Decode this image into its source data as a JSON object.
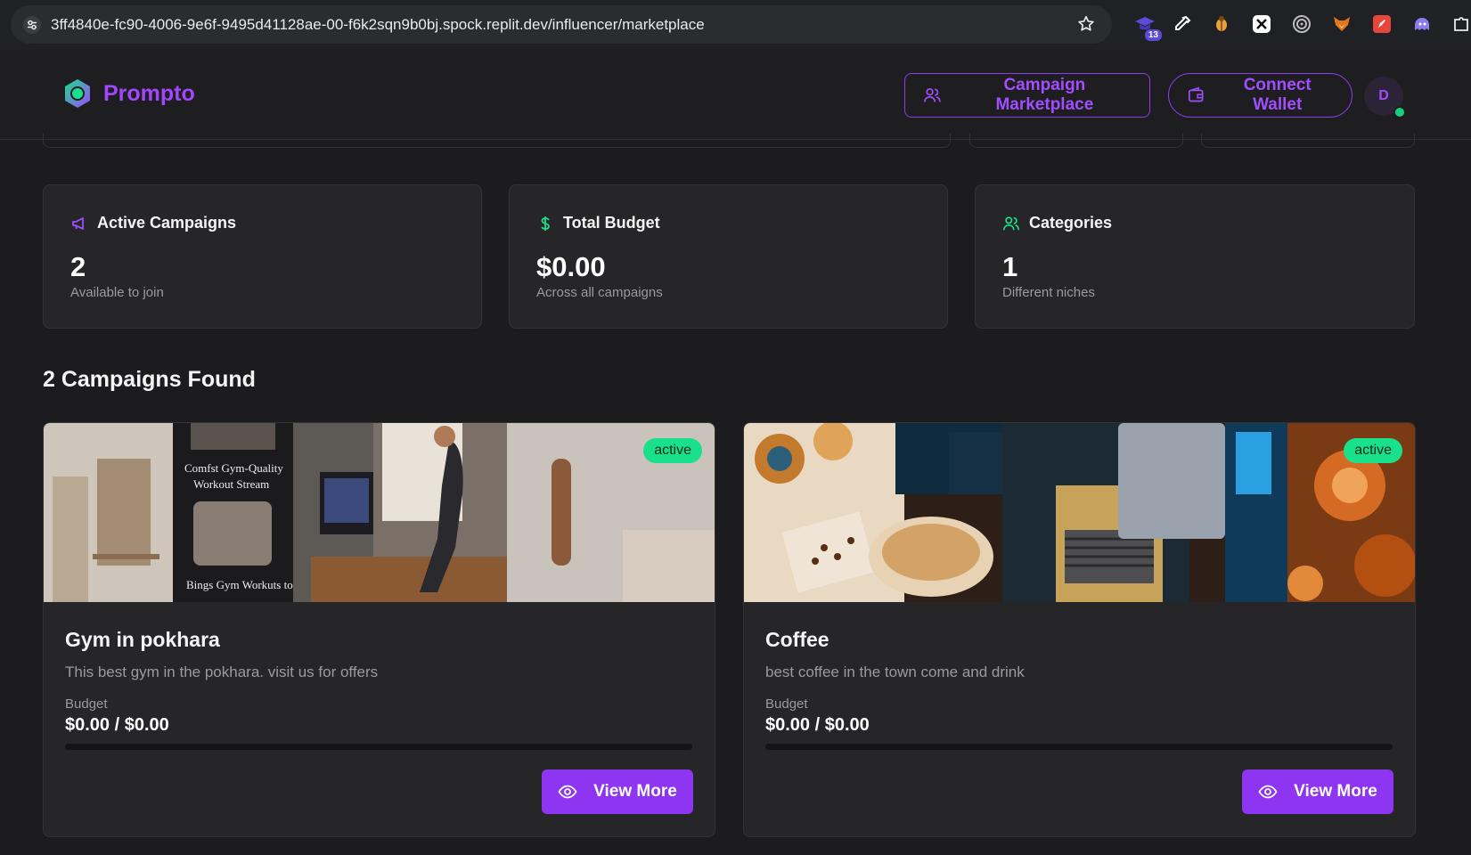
{
  "browser": {
    "url": "3ff4840e-fc90-4006-9e6f-9495d41128ae-00-f6k2sqn9b0bj.spock.replit.dev/influencer/marketplace",
    "extension_badge": "13",
    "extensions": [
      "graduation-cap-icon",
      "eyedropper-icon",
      "bug-icon",
      "x-icon",
      "target-icon",
      "fox-icon",
      "rocket-icon",
      "ghost-icon",
      "puzzle-icon"
    ]
  },
  "header": {
    "brand": "Prompto",
    "marketplace_label": "Campaign Marketplace",
    "wallet_label": "Connect Wallet",
    "avatar_initial": "D",
    "accent": "#a24dff"
  },
  "stats": [
    {
      "title": "Active Campaigns",
      "value": "2",
      "sub": "Available to join",
      "icon": "megaphone-icon",
      "icon_color": "#a24dff"
    },
    {
      "title": "Total Budget",
      "value": "$0.00",
      "sub": "Across all campaigns",
      "icon": "dollar-icon",
      "icon_color": "#19e08a"
    },
    {
      "title": "Categories",
      "value": "1",
      "sub": "Different niches",
      "icon": "users-icon",
      "icon_color": "#19e08a"
    }
  ],
  "section_title": "2 Campaigns Found",
  "campaigns": [
    {
      "title": "Gym in pokhara",
      "description": "This best gym in the pokhara. visit us for offers",
      "status": "active",
      "budget_label": "Budget",
      "budget": "$0.00 / $0.00",
      "budget_progress": 0,
      "button_label": "View More",
      "image_text_1": "Comfst Gym-Quality",
      "image_text_2": "Workout Stream",
      "image_text_3": "Bings Gym Workuts to"
    },
    {
      "title": "Coffee",
      "description": "best coffee in the town come and drink",
      "status": "active",
      "budget_label": "Budget",
      "budget": "$0.00 / $0.00",
      "budget_progress": 0,
      "button_label": "View More"
    }
  ]
}
